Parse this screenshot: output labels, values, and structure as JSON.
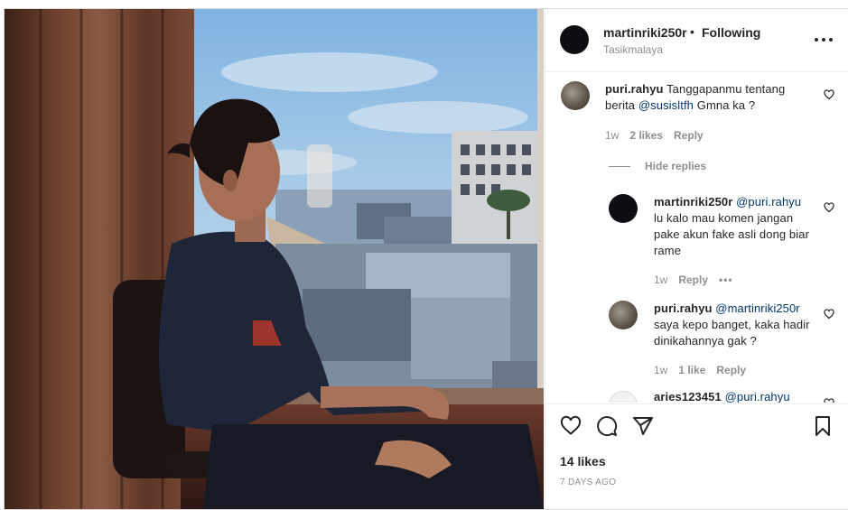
{
  "post": {
    "username": "martinriki250r",
    "separator": "•",
    "follow_status": "Following",
    "location": "Tasikmalaya"
  },
  "comments": [
    {
      "username": "puri.rahyu",
      "text_before": "Tanggapanmu tentang berita ",
      "mention": "@susisltfh",
      "text_after": " Gmna ka ?",
      "time": "1w",
      "likes": "2 likes",
      "reply_label": "Reply",
      "hide_replies_label": "Hide replies",
      "replies": [
        {
          "username": "martinriki250r",
          "mention": "@puri.rahyu",
          "text": "lu kalo mau komen jangan pake akun fake asli dong biar rame",
          "time": "1w",
          "reply_label": "Reply",
          "more": "•••"
        },
        {
          "username": "puri.rahyu",
          "mention": "@martinriki250r",
          "text": "saya kepo banget, kaka hadir dinikahannya gak ?",
          "time": "1w",
          "likes": "1 like",
          "reply_label": "Reply"
        },
        {
          "username": "aries123451",
          "mention": "@puri.rahyu",
          "text": ""
        }
      ]
    }
  ],
  "engagement": {
    "likes": "14 likes",
    "date": "7 DAYS AGO"
  },
  "icons": {
    "like": "heart-icon",
    "comment": "comment-icon",
    "share": "paper-plane-icon",
    "save": "bookmark-icon",
    "more": "more-options-icon"
  }
}
